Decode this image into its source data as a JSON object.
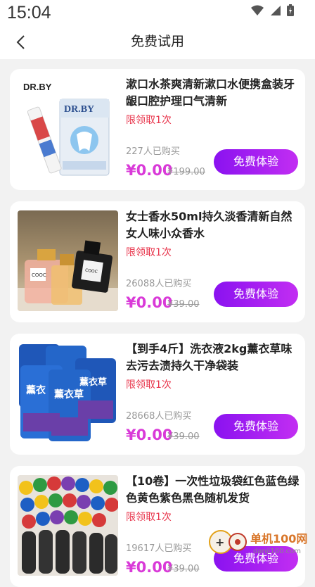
{
  "status": {
    "time": "15:04"
  },
  "header": {
    "title": "免费试用"
  },
  "products": [
    {
      "brand": "DR.BY",
      "title": "漱口水茶爽清新漱口水便携盒装牙龈口腔护理口气清新",
      "limit": "限领取1次",
      "sold": "227人已购买",
      "price": "¥0.00",
      "original": "¥199.00",
      "button": "免费体验"
    },
    {
      "title": "女士香水50ml持久淡香清新自然女人味小众香水",
      "limit": "限领取1次",
      "sold": "26088人已购买",
      "price": "¥0.00",
      "original": "¥39.00",
      "button": "免费体验"
    },
    {
      "title": "【到手4斤】洗衣液2kg薰衣草味去污去渍持久干净袋装",
      "limit": "限领取1次",
      "sold": "28668人已购买",
      "price": "¥0.00",
      "original": "¥39.00",
      "button": "免费体验"
    },
    {
      "title": "【10卷】一次性垃圾袋红色蓝色绿色黄色紫色黑色随机发货",
      "limit": "限领取1次",
      "sold": "19617人已购买",
      "price": "¥0.00",
      "original": "¥39.00",
      "button": "免费体验"
    }
  ],
  "watermark": {
    "name": "单机100网",
    "url": "danji100.com"
  },
  "colors": {
    "accent": "#d93ad8",
    "button_start": "#8a12f0",
    "button_end": "#c22ef2",
    "limit": "#e8334a"
  }
}
